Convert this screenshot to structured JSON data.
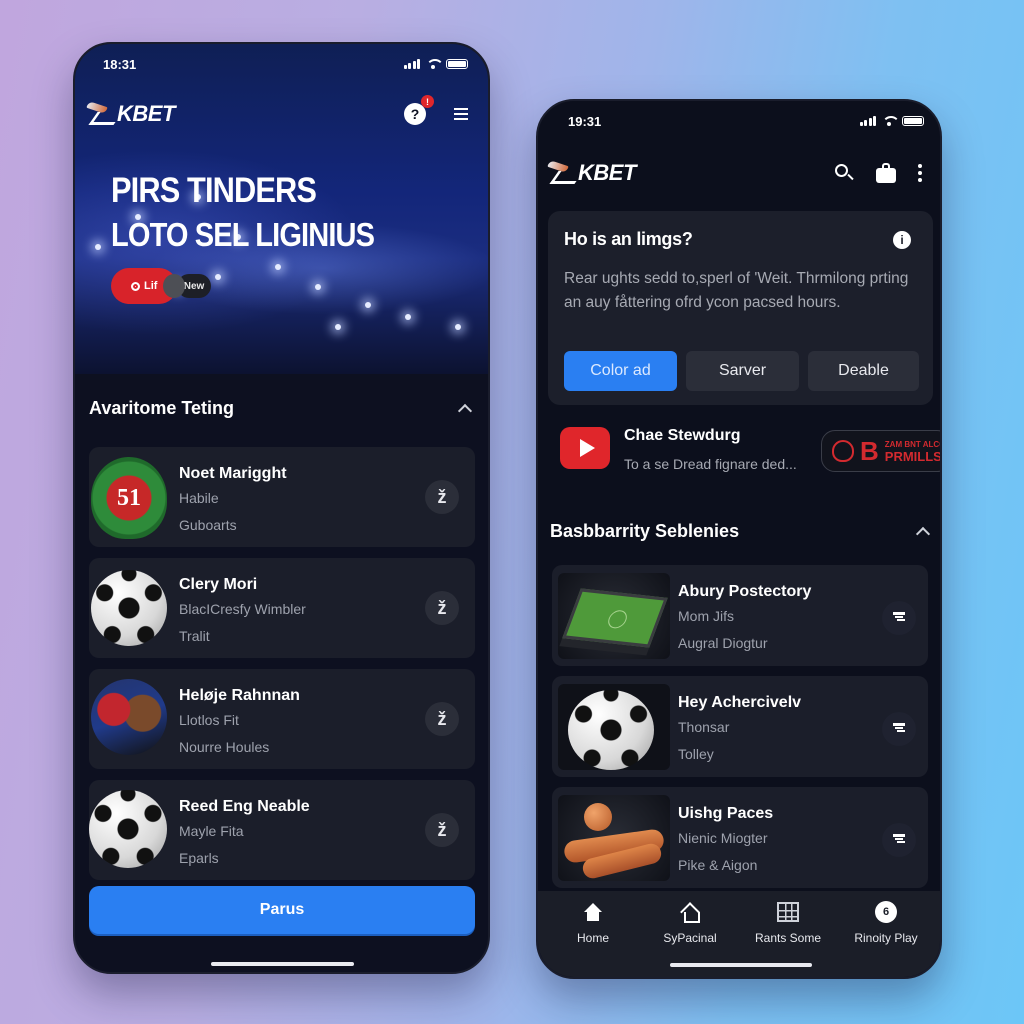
{
  "left_phone": {
    "status": {
      "time": "18:31"
    },
    "brand": "KBET",
    "header": {
      "help_icon": "question-icon",
      "help_badge": "!",
      "menu_icon": "hamburger-icon"
    },
    "hero": {
      "title_line1": "PIRS TINDERS",
      "title_line2": "LOTO SEL LIGINIUS",
      "toggle_on_label": "Lif",
      "toggle_off_label": "New"
    },
    "section": {
      "title": "Avaritome Teting",
      "collapse_icon": "chevron-up-icon"
    },
    "items": [
      {
        "title": "Noet Marigght",
        "line1": "Habile",
        "line2": "Guboarts",
        "thumb": "team-crest",
        "action_icon": "z-arrow-icon",
        "action_glyph": "ž"
      },
      {
        "title": "Clery Mori",
        "line1": "BlacICresfy Wimbler",
        "line2": "Tralit",
        "thumb": "soccer-ball",
        "action_icon": "z-arrow-icon",
        "action_glyph": "ž"
      },
      {
        "title": "Heløje Rahnnan",
        "line1": "Llotlos Fit",
        "line2": "Nourre Houles",
        "thumb": "player-photo",
        "action_icon": "z-arrow-icon",
        "action_glyph": "ž"
      },
      {
        "title": "Reed Eng Neable",
        "line1": "Mayle Fita",
        "line2": "Eparls",
        "thumb": "soccer-ball",
        "action_icon": "z-arrow-icon",
        "action_glyph": "ž"
      }
    ],
    "primary_button": "Parus"
  },
  "right_phone": {
    "status": {
      "time": "19:31"
    },
    "brand": "KBET",
    "header": {
      "search_icon": "search-icon",
      "bag_icon": "shopping-bag-icon",
      "more_icon": "more-vertical-icon"
    },
    "info_card": {
      "title": "Ho is an limgs?",
      "info_glyph": "i",
      "body": "Rear ughts sedd to,sperl of 'Weit. Thrmilong prting an auy fåttering ofrd ycon pacsed hours.",
      "buttons": [
        "Color ad",
        "Sarver",
        "Deable"
      ]
    },
    "video_row": {
      "title": "Chae Stewdurg",
      "subtitle": "To a se Dread fignare ded...",
      "badge_letter": "B",
      "badge_small": "ZAM BNT ALCO",
      "badge_big": "PRMILLS"
    },
    "section": {
      "title": "Basbbarrity Seblenies",
      "collapse_icon": "chevron-up-icon"
    },
    "items": [
      {
        "title": "Abury Postectory",
        "line1": "Mom Jifs",
        "line2": "Augral Diogtur",
        "thumb": "pitch-box",
        "action_icon": "filter-icon"
      },
      {
        "title": "Hey Achercivelv",
        "line1": "Thonsar",
        "line2": "Tolley",
        "thumb": "soccer-ball",
        "action_icon": "filter-icon"
      },
      {
        "title": "Uishg Paces",
        "line1": "Nienic Miogter",
        "line2": "Pike & Aigon",
        "thumb": "rolls",
        "action_icon": "filter-icon"
      }
    ],
    "bottom_nav": [
      {
        "label": "Home",
        "icon": "home-filled-icon"
      },
      {
        "label": "SyPacinal",
        "icon": "home-outline-icon"
      },
      {
        "label": "Rants Some",
        "icon": "grid-icon"
      },
      {
        "label": "Rinoity Play",
        "icon": "play-circle-icon",
        "glyph": "6"
      }
    ]
  },
  "colors": {
    "accent_blue": "#2a7ff2",
    "alert_red": "#e0262b",
    "card_bg": "#1b1e2a",
    "screen_bg": "#0d1020"
  }
}
